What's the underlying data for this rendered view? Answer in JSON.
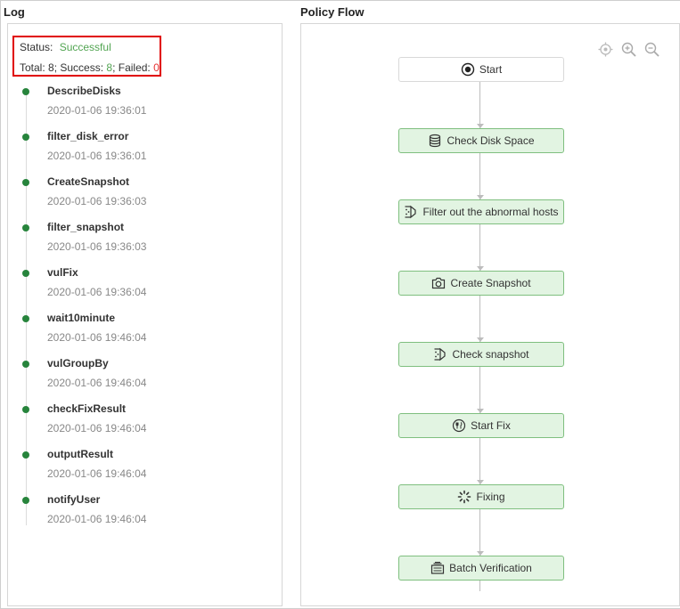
{
  "log": {
    "title": "Log",
    "summary": {
      "status_label": "Status:",
      "status_value": "Successful",
      "total_label": "Total: 8; Success: ",
      "success_value": "8",
      "failed_label": "; Failed: ",
      "failed_value": "0"
    },
    "items": [
      {
        "name": "DescribeDisks",
        "time": "2020-01-06 19:36:01"
      },
      {
        "name": "filter_disk_error",
        "time": "2020-01-06 19:36:01"
      },
      {
        "name": "CreateSnapshot",
        "time": "2020-01-06 19:36:03"
      },
      {
        "name": "filter_snapshot",
        "time": "2020-01-06 19:36:03"
      },
      {
        "name": "vulFix",
        "time": "2020-01-06 19:36:04"
      },
      {
        "name": "wait10minute",
        "time": "2020-01-06 19:46:04"
      },
      {
        "name": "vulGroupBy",
        "time": "2020-01-06 19:46:04"
      },
      {
        "name": "checkFixResult",
        "time": "2020-01-06 19:46:04"
      },
      {
        "name": "outputResult",
        "time": "2020-01-06 19:46:04"
      },
      {
        "name": "notifyUser",
        "time": "2020-01-06 19:46:04"
      }
    ]
  },
  "flow": {
    "title": "Policy Flow",
    "tools": [
      "reset-view-icon",
      "zoom-in-icon",
      "zoom-out-icon"
    ],
    "nodes": [
      {
        "label": "Start",
        "icon": "start-icon"
      },
      {
        "label": "Check Disk Space",
        "icon": "database-icon"
      },
      {
        "label": "Filter out the abnormal hosts",
        "icon": "filter-icon"
      },
      {
        "label": "Create Snapshot",
        "icon": "camera-icon"
      },
      {
        "label": "Check snapshot",
        "icon": "filter-icon"
      },
      {
        "label": "Start Fix",
        "icon": "fix-icon"
      },
      {
        "label": "Fixing",
        "icon": "spinner-icon"
      },
      {
        "label": "Batch Verification",
        "icon": "batch-icon"
      }
    ]
  },
  "colors": {
    "success": "#52a552",
    "failed": "#e63030",
    "highlight_border": "#e00000",
    "node_fill": "#e2f4e2",
    "node_border": "#7fbf7f",
    "dot": "#27843c"
  }
}
